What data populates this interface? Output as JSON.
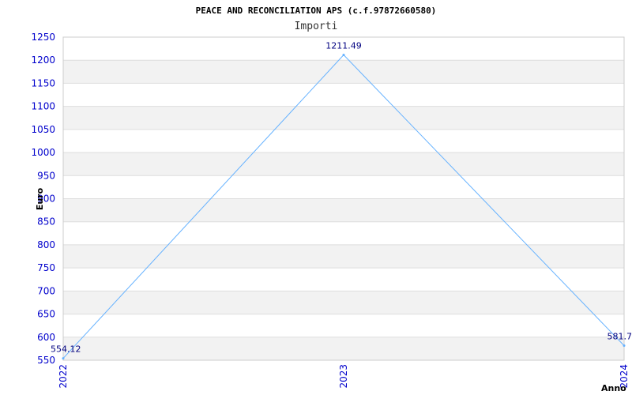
{
  "chart_data": {
    "type": "line",
    "title": "PEACE AND RECONCILIATION APS (c.f.97872660580)",
    "subtitle": "Importi",
    "xlabel": "Anno",
    "ylabel": "Euro",
    "x": [
      "2022",
      "2023",
      "2024"
    ],
    "series": [
      {
        "values": [
          554.12,
          1211.49,
          581.7
        ],
        "labels": [
          "554.12",
          "1211.49",
          "581.7"
        ]
      }
    ],
    "ylim": [
      550,
      1250
    ],
    "yticks": [
      550,
      600,
      650,
      700,
      750,
      800,
      850,
      900,
      950,
      1000,
      1050,
      1100,
      1150,
      1200,
      1250
    ],
    "grid": "horizontal alternating bands",
    "colors": {
      "line": "#66b2ff",
      "band": "#f2f2f2",
      "grid": "#dddddd",
      "tick": "#0000cc",
      "data_label": "#000080"
    }
  }
}
